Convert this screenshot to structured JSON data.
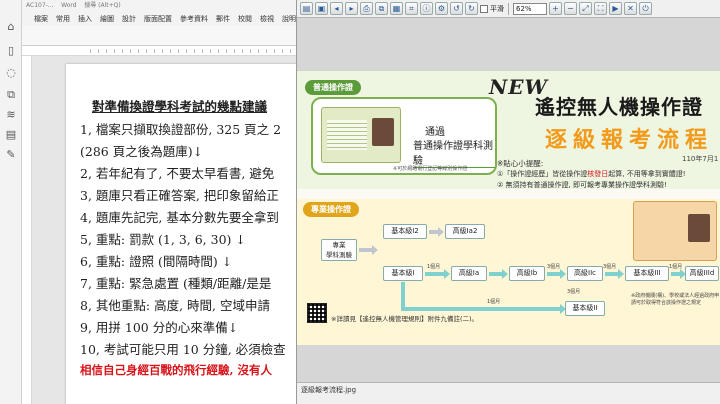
{
  "word": {
    "title_left": "AC107-...",
    "title_mid": "Word",
    "search_placeholder": "搜尋 (Alt+Q)",
    "menu": [
      "檔案",
      "常用",
      "插入",
      "繪圖",
      "設計",
      "版面配置",
      "參考資料",
      "郵件",
      "校閱",
      "檢視",
      "說明"
    ],
    "doc": {
      "title": "對準備換證學科考試的幾點建議",
      "lines": [
        "1, 檔案只擷取換證部份, 325 頁之 2",
        "(286 頁之後為題庫)↓",
        "2, 若年紀有了, 不要太早看書, 避免",
        "3, 題庫只看正確答案, 把印象留給正",
        "4, 題庫先記完, 基本分數先要全拿到",
        "5, 重點: 罰款 (1, 3, 6, 30) ↓",
        "6, 重點: 證照 (間隔時間) ↓",
        "7, 重點: 緊急處置 (種類/距離/是是",
        "8, 其他重點: 高度, 時間, 空域申請",
        "9, 用拼 100 分的心來準備↓",
        "10, 考試可能只用 10 分鐘, 必須檢查"
      ],
      "red_line": "相信自己身經百戰的飛行經驗, 沒有人"
    }
  },
  "viewer": {
    "zoom": "62%",
    "check_label": "平滑",
    "status": "逐級報考流程.jpg"
  },
  "flow": {
    "section1": "普通操作證",
    "section2": "專業操作證",
    "card_line1": "通過",
    "card_line2": "普通操作證學科測驗",
    "card_note": "※可於網路電行登記等線別操作證",
    "new": "NEW",
    "title_main": "遙控無人機操作證",
    "title_sub": "逐級報考流程",
    "date": "110年7月1",
    "tip_head": "※貼心小提醒:",
    "tip1_a": "①「操作證經歷」皆從操作證",
    "tip1_b": "核發日",
    "tip1_c": "起算, 不用等拿到實體證!",
    "tip2": "② 無須持有普通操作證, 即可報考專業操作證學科測驗!",
    "start": "專業\n學科測驗",
    "boxes": {
      "basic_i2": "基本級I2",
      "adv_ia2": "高級Ia2",
      "basic_i": "基本級I",
      "adv_ia": "高級Ia",
      "adv_ib": "高級Ib",
      "adv_iic": "高級IIc",
      "basic_iii": "基本級III",
      "adv_iiid": "高級IIId",
      "basic_ii": "基本級II"
    },
    "labels": {
      "m1": "1個月",
      "m3a": "3個月",
      "m3b": "3個月",
      "m1b": "1個月",
      "m3c": "3個月",
      "m1c": "1個月"
    },
    "footer_note": "※詳讀見【遙控無人機管理規則】附件九備註(二)。",
    "side_note": "※政府機關(構)、學校或法人經過政府申請可於取得符合該操作證之規定"
  }
}
